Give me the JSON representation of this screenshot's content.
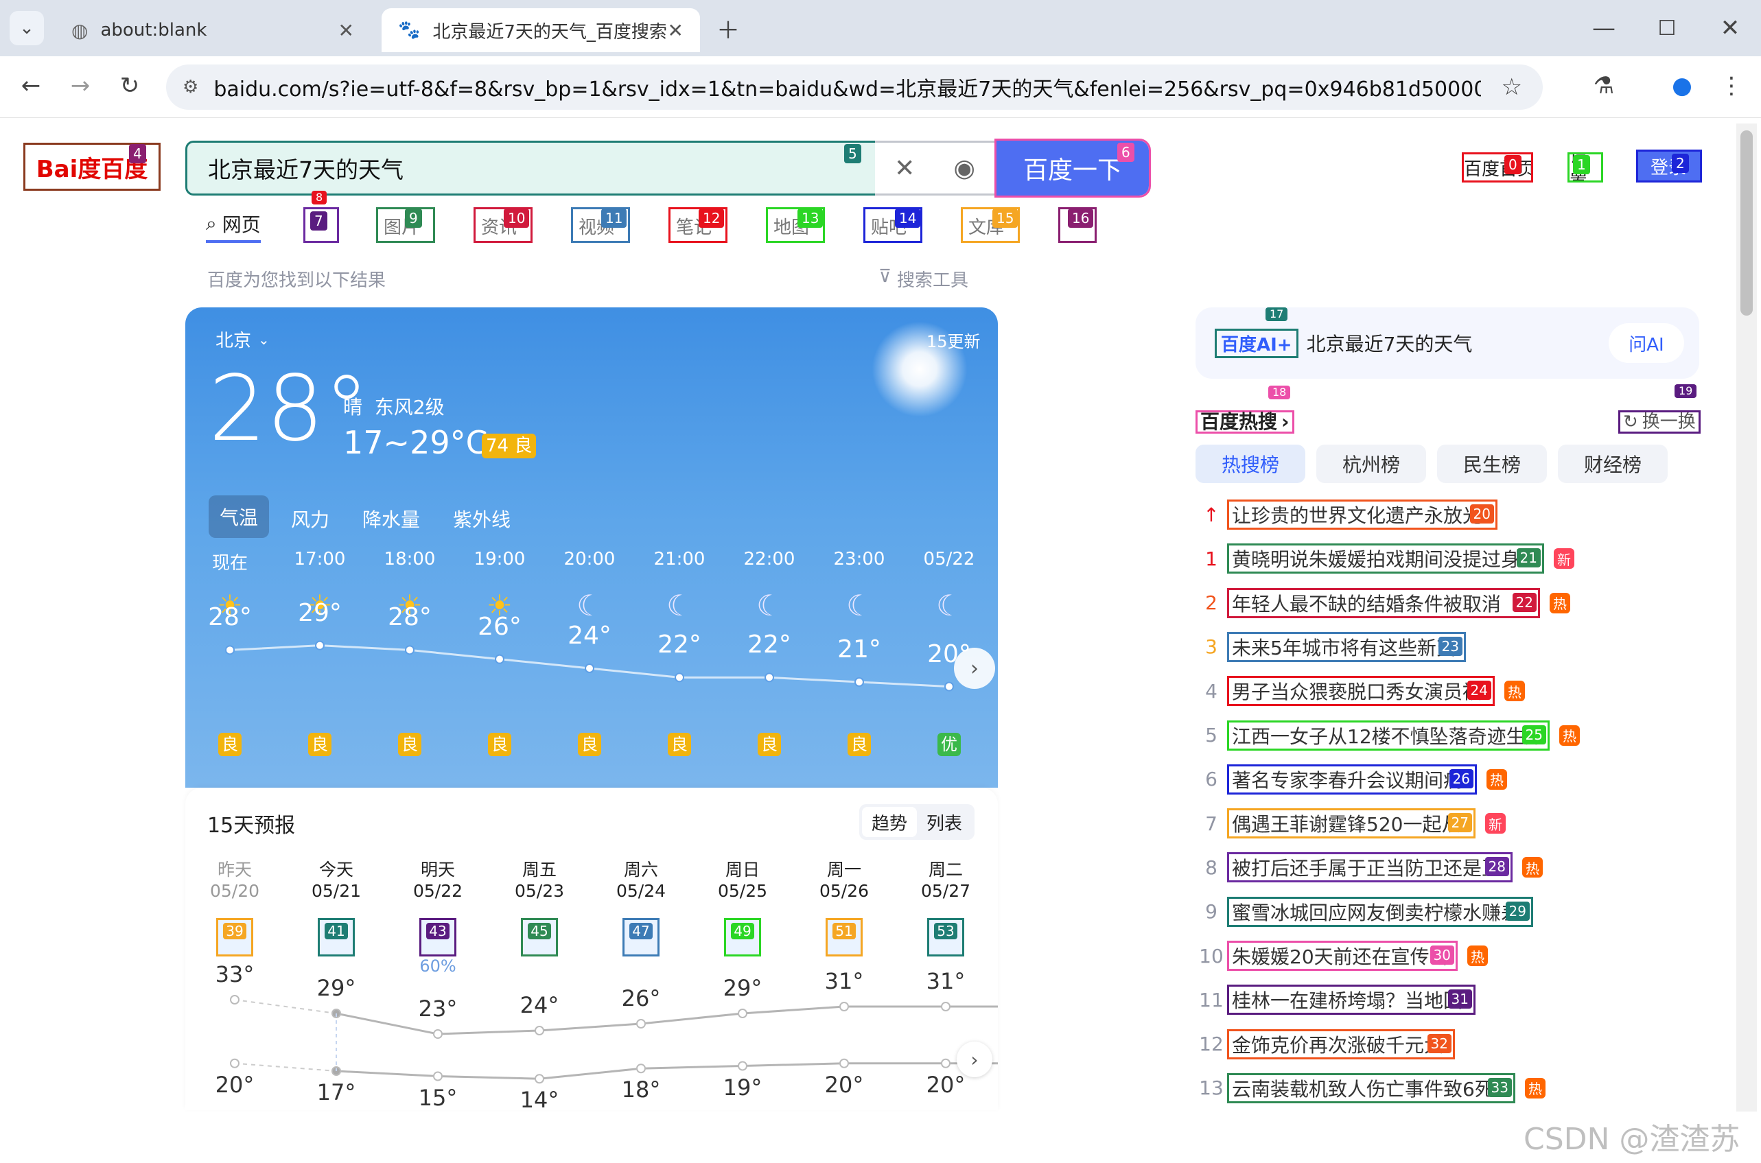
{
  "browser": {
    "tabs": [
      {
        "title": "about:blank"
      },
      {
        "title": "北京最近7天的天气_百度搜索"
      }
    ],
    "url": "baidu.com/s?ie=utf-8&f=8&rsv_bp=1&rsv_idx=1&tn=baidu&wd=北京最近7天的天气&fenlei=256&rsv_pq=0x946b81d50000a732&rsv_t=6..."
  },
  "header": {
    "logo_text": "Bai度百度",
    "search_value": "北京最近7天的天气",
    "search_button": "百度一下",
    "top_links": [
      "百度首页",
      "设置",
      "登录"
    ]
  },
  "nav_tabs": [
    "网页",
    "AI",
    "图片",
    "资讯",
    "视频",
    "笔记",
    "地图",
    "贴吧",
    "文库",
    "更多"
  ],
  "result_hint": "百度为您找到以下结果",
  "search_tools": "搜索工具",
  "weather": {
    "city": "北京",
    "update": "15更新",
    "temp": "28°",
    "condition": "晴  东风2级",
    "range": "17~29°C",
    "aqi": "74 良",
    "tabs": [
      "气温",
      "风力",
      "降水量",
      "紫外线"
    ],
    "hours": [
      "现在",
      "17:00",
      "18:00",
      "19:00",
      "20:00",
      "21:00",
      "22:00",
      "23:00",
      "05/22"
    ],
    "hour_icons": [
      "sun-icon",
      "sun-icon",
      "sun-icon",
      "sun-icon",
      "moon-icon",
      "moon-icon",
      "moon-icon",
      "moon-icon",
      "moon-icon"
    ],
    "hour_temps": [
      "28°",
      "29°",
      "28°",
      "26°",
      "24°",
      "22°",
      "22°",
      "21°",
      "20°"
    ],
    "hour_temp_values": [
      28,
      29,
      28,
      26,
      24,
      22,
      22,
      21,
      20
    ],
    "hour_aqi": [
      "良",
      "良",
      "良",
      "良",
      "良",
      "良",
      "良",
      "良",
      "优"
    ],
    "colors": {
      "aqi_good": "#f2b40d",
      "aqi_excellent": "#3bb94a"
    }
  },
  "forecast": {
    "title": "15天预报",
    "toggle": [
      "趋势",
      "列表"
    ],
    "days": [
      {
        "name": "昨天",
        "date": "05/20",
        "high": "33°",
        "low": "20°",
        "badge": "39"
      },
      {
        "name": "今天",
        "date": "05/21",
        "high": "29°",
        "low": "17°",
        "badge": "41"
      },
      {
        "name": "明天",
        "date": "05/22",
        "high": "23°",
        "low": "15°",
        "badge": "43",
        "rain": "60%"
      },
      {
        "name": "周五",
        "date": "05/23",
        "high": "24°",
        "low": "14°",
        "badge": "45"
      },
      {
        "name": "周六",
        "date": "05/24",
        "high": "26°",
        "low": "18°",
        "badge": "47"
      },
      {
        "name": "周日",
        "date": "05/25",
        "high": "29°",
        "low": "19°",
        "badge": "49"
      },
      {
        "name": "周一",
        "date": "05/26",
        "high": "31°",
        "low": "20°",
        "badge": "51"
      },
      {
        "name": "周二",
        "date": "05/27",
        "high": "31°",
        "low": "20°",
        "badge": "53"
      }
    ],
    "high_values": [
      33,
      29,
      23,
      24,
      26,
      29,
      31,
      31
    ],
    "low_values": [
      20,
      17,
      15,
      14,
      18,
      19,
      20,
      20
    ]
  },
  "ai_card": {
    "logo": "百度AI+",
    "query": "北京最近7天的天气",
    "ask": "问AI"
  },
  "hot": {
    "title": "百度热搜",
    "refresh": "换一换",
    "categories": [
      "热搜榜",
      "杭州榜",
      "民生榜",
      "财经榜"
    ],
    "items": [
      {
        "rank": "↑",
        "title": "让珍贵的世界文化遗产永放光",
        "badge": "20",
        "tag": ""
      },
      {
        "rank": "1",
        "title": "黄晓明说朱媛媛拍戏期间没提过身",
        "badge": "21",
        "tag": "新"
      },
      {
        "rank": "2",
        "title": "年轻人最不缺的结婚条件被取消",
        "badge": "22",
        "tag": "热"
      },
      {
        "rank": "3",
        "title": "未来5年城市将有这些新变",
        "badge": "23",
        "tag": ""
      },
      {
        "rank": "4",
        "title": "男子当众猥亵脱口秀女演员被",
        "badge": "24",
        "tag": "热"
      },
      {
        "rank": "5",
        "title": "江西一女子从12楼不慎坠落奇迹生还",
        "badge": "25",
        "tag": "热"
      },
      {
        "rank": "6",
        "title": "著名专家李春升会议期间病",
        "badge": "26",
        "tag": "热"
      },
      {
        "rank": "7",
        "title": "偶遇王菲谢霆锋520一起从",
        "badge": "27",
        "tag": "新"
      },
      {
        "rank": "8",
        "title": "被打后还手属于正当防卫还是互",
        "badge": "28",
        "tag": "热"
      },
      {
        "rank": "9",
        "title": "蜜雪冰城回应网友倒卖柠檬水赚差",
        "badge": "29",
        "tag": ""
      },
      {
        "rank": "10",
        "title": "朱媛媛20天前还在宣传新",
        "badge": "30",
        "tag": "热"
      },
      {
        "rank": "11",
        "title": "桂林一在建桥垮塌？当地回",
        "badge": "31",
        "tag": ""
      },
      {
        "rank": "12",
        "title": "金饰克价再次涨破千元大",
        "badge": "32",
        "tag": ""
      },
      {
        "rank": "13",
        "title": "云南装载机致人伤亡事件致6死",
        "badge": "33",
        "tag": "热"
      }
    ]
  },
  "watermark": "CSDN @渣渣苏"
}
